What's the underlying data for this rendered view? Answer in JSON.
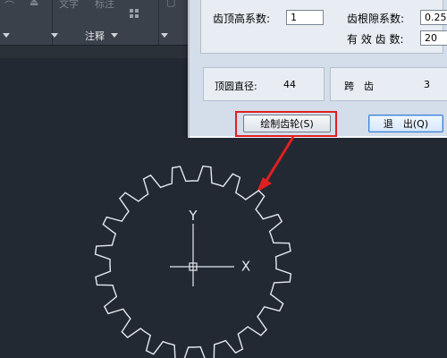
{
  "ribbon": {
    "top_labels": [
      "文字",
      "标注"
    ],
    "section_label": "注释"
  },
  "dialog": {
    "tooth_top_label": "齿顶高系数:",
    "tooth_top_value": "1",
    "root_clearance_label": "齿根隙系数:",
    "root_clearance_value": "0.25",
    "effective_teeth_label": "有 效 齿 数:",
    "effective_teeth_value": "20",
    "tip_diameter_label": "顶圆直径:",
    "tip_diameter_value": "44",
    "span_teeth_label": "跨　齿",
    "span_teeth_value": "3",
    "draw_gear_button": "绘制齿轮(S)",
    "exit_button": "退　出(Q)"
  },
  "canvas": {
    "axis_y_label": "Y",
    "axis_x_label": "X",
    "gear_teeth": 20
  },
  "colors": {
    "canvas_bg": "#222933",
    "dialog_bg": "#d4ddea",
    "highlight_red": "#e02020",
    "gear_line": "#e6e9ee"
  }
}
